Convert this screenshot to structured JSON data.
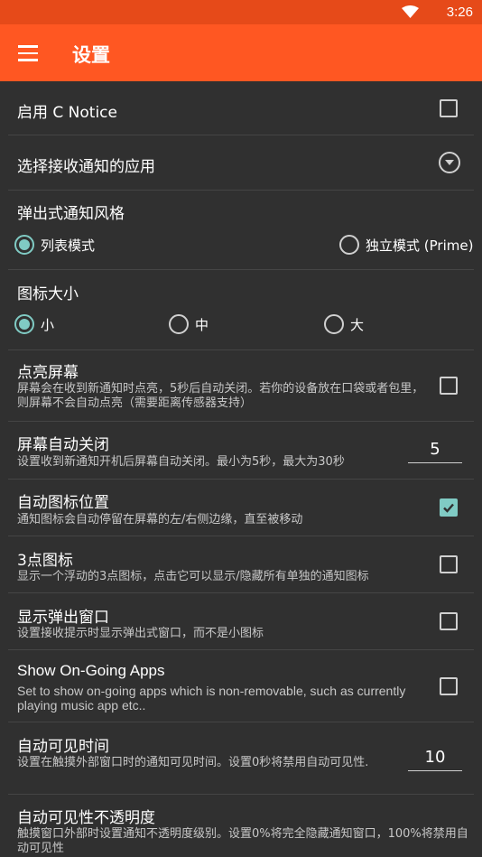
{
  "status_bar": {
    "time": "3:26",
    "icons": [
      "wifi-icon"
    ]
  },
  "app_bar": {
    "title": "设置",
    "icon": "menu-icon"
  },
  "settings": {
    "enable": {
      "title": "启用 C Notice",
      "checked": false
    },
    "select_apps": {
      "title": "选择接收通知的应用",
      "icon": "chevron-down-circle-icon"
    },
    "popup_style": {
      "title": "弹出式通知风格",
      "options": [
        "列表模式",
        "独立模式 (Prime)"
      ],
      "selected": "列表模式"
    },
    "icon_size": {
      "title": "图标大小",
      "options": [
        "小",
        "中",
        "大"
      ],
      "selected": "小"
    },
    "wake_screen": {
      "title": "点亮屏幕",
      "summary": "屏幕会在收到新通知时点亮，5秒后自动关闭。若你的设备放在口袋或者包里，则屏幕不会自动点亮（需要距离传感器支持）",
      "checked": false
    },
    "auto_screen_off": {
      "title": "屏幕自动关闭",
      "summary": "设置收到新通知开机后屏幕自动关闭。最小为5秒，最大为30秒",
      "value": "5"
    },
    "auto_icon_position": {
      "title": "自动图标位置",
      "summary": "通知图标会自动停留在屏幕的左/右侧边缘，直至被移动",
      "checked": true
    },
    "three_dot_icon": {
      "title": "3点图标",
      "summary": "显示一个浮动的3点图标，点击它可以显示/隐藏所有单独的通知图标",
      "checked": false
    },
    "show_popup": {
      "title": "显示弹出窗口",
      "summary": "设置接收提示时显示弹出式窗口，而不是小图标",
      "checked": false
    },
    "ongoing_apps": {
      "title": "Show On-Going Apps",
      "summary": "Set to show on-going apps which is non-removable, such as currently playing music app etc..",
      "checked": false
    },
    "auto_visible_time": {
      "title": "自动可见时间",
      "summary": "设置在触摸外部窗口时的通知可见时间。设置0秒将禁用自动可见性.",
      "value": "10"
    },
    "auto_visible_opacity": {
      "title": "自动可见性不透明度",
      "summary": "触摸窗口外部时设置通知不透明度级别。设置0%将完全隐藏通知窗口，100%将禁用自动可见性"
    }
  },
  "colors": {
    "status_bar": "#e64a19",
    "app_bar": "#ff5722",
    "background": "#303030",
    "accent": "#80cbc4"
  }
}
